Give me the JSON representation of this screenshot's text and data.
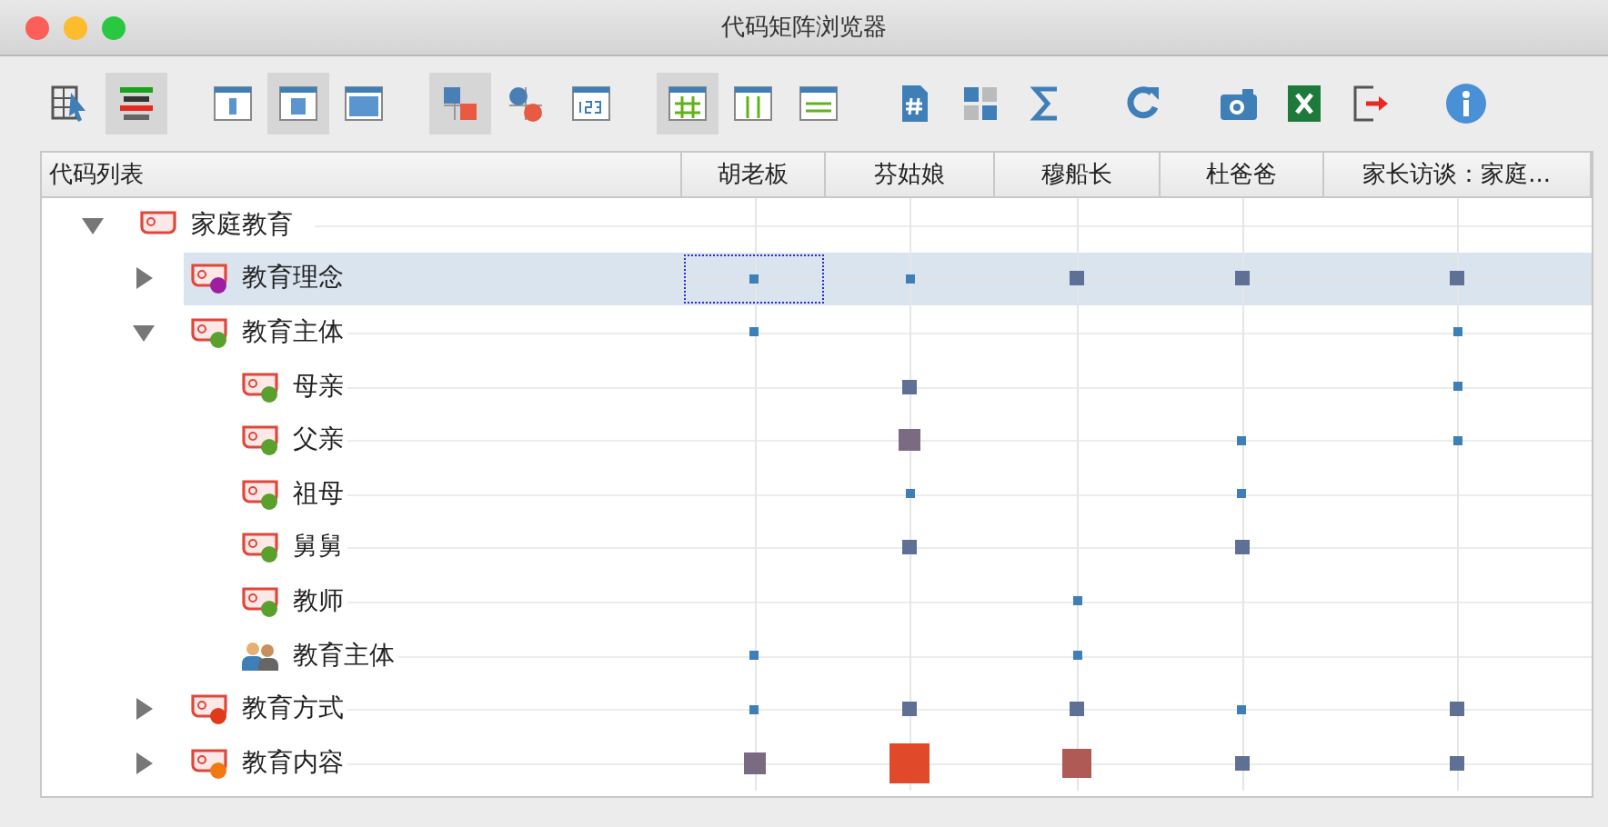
{
  "window": {
    "title": "代码矩阵浏览器"
  },
  "toolbar": [
    [
      {
        "kind": "select-grid",
        "selected": false
      },
      {
        "kind": "color-bars",
        "selected": true
      }
    ],
    [
      {
        "kind": "panel-narrow",
        "selected": false
      },
      {
        "kind": "panel-medium",
        "selected": true
      },
      {
        "kind": "panel-wide",
        "selected": false
      }
    ],
    [
      {
        "kind": "squares",
        "selected": true
      },
      {
        "kind": "circles",
        "selected": false
      },
      {
        "kind": "numbers",
        "selected": false
      }
    ],
    [
      {
        "kind": "grid-hash",
        "selected": true
      },
      {
        "kind": "grid-cols",
        "selected": false
      },
      {
        "kind": "grid-rows",
        "selected": false
      }
    ],
    [
      {
        "kind": "doc-hash",
        "selected": false
      },
      {
        "kind": "tiles",
        "selected": false
      },
      {
        "kind": "sigma",
        "selected": false
      }
    ],
    [
      {
        "kind": "refresh",
        "selected": false
      }
    ],
    [
      {
        "kind": "camera",
        "selected": false
      },
      {
        "kind": "excel",
        "selected": false
      },
      {
        "kind": "export",
        "selected": false
      }
    ],
    [
      {
        "kind": "info",
        "selected": false
      }
    ]
  ],
  "matrix": {
    "tree_header": "代码列表",
    "columns": [
      "胡老板",
      "芬姑娘",
      "穆船长",
      "杜爸爸",
      "家长访谈：家庭..."
    ],
    "tree": [
      {
        "label": "家庭教育",
        "kind": "code",
        "expanded": true,
        "selected": false,
        "cells": [
          null,
          null,
          null,
          null,
          null
        ],
        "children": [
          {
            "label": "教育理念",
            "kind": "code",
            "color": "#9b1fa0",
            "expanded": false,
            "selected": true,
            "cells": [
              {
                "kind": "tiny",
                "color": "#3f7fb8"
              },
              {
                "kind": "tiny",
                "color": "#3f7fb8"
              },
              {
                "kind": "small",
                "color": "#5e7194"
              },
              {
                "kind": "small",
                "color": "#5e7194"
              },
              {
                "kind": "small",
                "color": "#5e7194"
              }
            ]
          },
          {
            "label": "教育主体",
            "kind": "code",
            "color": "#5aa02c",
            "expanded": true,
            "selected": false,
            "cells": [
              {
                "kind": "tiny",
                "color": "#3f7fb8"
              },
              null,
              null,
              null,
              {
                "kind": "tiny",
                "color": "#3f7fb8"
              }
            ],
            "children": [
              {
                "label": "母亲",
                "kind": "code",
                "color": "#5aa02c",
                "selected": false,
                "cells": [
                  null,
                  {
                    "kind": "small",
                    "color": "#5e7194"
                  },
                  null,
                  null,
                  {
                    "kind": "tiny",
                    "color": "#3f7fb8"
                  }
                ]
              },
              {
                "label": "父亲",
                "kind": "code",
                "color": "#5aa02c",
                "selected": false,
                "cells": [
                  null,
                  {
                    "kind": "medium",
                    "color": "#7a6a82"
                  },
                  null,
                  {
                    "kind": "tiny",
                    "color": "#3f7fb8"
                  },
                  {
                    "kind": "tiny",
                    "color": "#3f7fb8"
                  }
                ]
              },
              {
                "label": "祖母",
                "kind": "code",
                "color": "#5aa02c",
                "selected": false,
                "cells": [
                  null,
                  {
                    "kind": "tiny",
                    "color": "#3f7fb8"
                  },
                  null,
                  {
                    "kind": "tiny",
                    "color": "#3f7fb8"
                  },
                  null
                ]
              },
              {
                "label": "舅舅",
                "kind": "code",
                "color": "#5aa02c",
                "selected": false,
                "cells": [
                  null,
                  {
                    "kind": "small",
                    "color": "#5e7194"
                  },
                  null,
                  {
                    "kind": "small",
                    "color": "#5e7194"
                  },
                  null
                ]
              },
              {
                "label": "教师",
                "kind": "code",
                "color": "#5aa02c",
                "selected": false,
                "cells": [
                  null,
                  null,
                  {
                    "kind": "tiny",
                    "color": "#3f7fb8"
                  },
                  null,
                  null
                ]
              },
              {
                "label": "教育主体",
                "kind": "set",
                "selected": false,
                "cells": [
                  {
                    "kind": "tiny",
                    "color": "#3f7fb8"
                  },
                  null,
                  {
                    "kind": "tiny",
                    "color": "#3f7fb8"
                  },
                  null,
                  null
                ]
              }
            ]
          },
          {
            "label": "教育方式",
            "kind": "code",
            "color": "#e03a1a",
            "expanded": false,
            "selected": false,
            "cells": [
              {
                "kind": "tiny",
                "color": "#3f7fb8"
              },
              {
                "kind": "small",
                "color": "#5e7194"
              },
              {
                "kind": "small",
                "color": "#5e7194"
              },
              {
                "kind": "tiny",
                "color": "#3f7fb8"
              },
              {
                "kind": "small",
                "color": "#5e7194"
              }
            ]
          },
          {
            "label": "教育内容",
            "kind": "code",
            "color": "#f07a10",
            "expanded": false,
            "selected": false,
            "cells": [
              {
                "kind": "medium",
                "color": "#7a6a82"
              },
              {
                "kind": "huge",
                "color": "#e04a2a"
              },
              {
                "kind": "big",
                "color": "#b05a55"
              },
              {
                "kind": "small",
                "color": "#5e7194"
              },
              {
                "kind": "small",
                "color": "#5e7194"
              }
            ]
          }
        ]
      }
    ]
  }
}
